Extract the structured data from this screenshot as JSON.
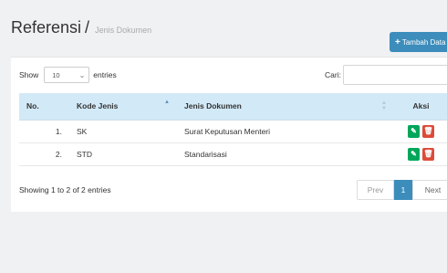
{
  "header": {
    "title": "Referensi",
    "separator": "/",
    "subtitle": "Jenis Dokumen"
  },
  "toolbar": {
    "add_label": "Tambah Data",
    "add_icon": "plus-icon"
  },
  "controls": {
    "show_label": "Show",
    "length_value": "10",
    "entries_label": "entries",
    "search_label": "Cari:",
    "search_value": ""
  },
  "table": {
    "headers": {
      "no": "No.",
      "kode": "Kode Jenis",
      "jenis": "Jenis Dokumen",
      "aksi": "Aksi"
    },
    "rows": [
      {
        "no": "1.",
        "kode": "SK",
        "jenis": "Surat Keputusan Menteri"
      },
      {
        "no": "2.",
        "kode": "STD",
        "jenis": "Standarisasi"
      }
    ]
  },
  "footer": {
    "info": "Showing 1 to 2 of 2 entries",
    "prev": "Prev",
    "current_page": "1",
    "next": "Next"
  },
  "colors": {
    "primary": "#3c8dbc",
    "edit": "#00a65a",
    "delete": "#dd4b39",
    "header_bg": "#d2e9f7"
  }
}
